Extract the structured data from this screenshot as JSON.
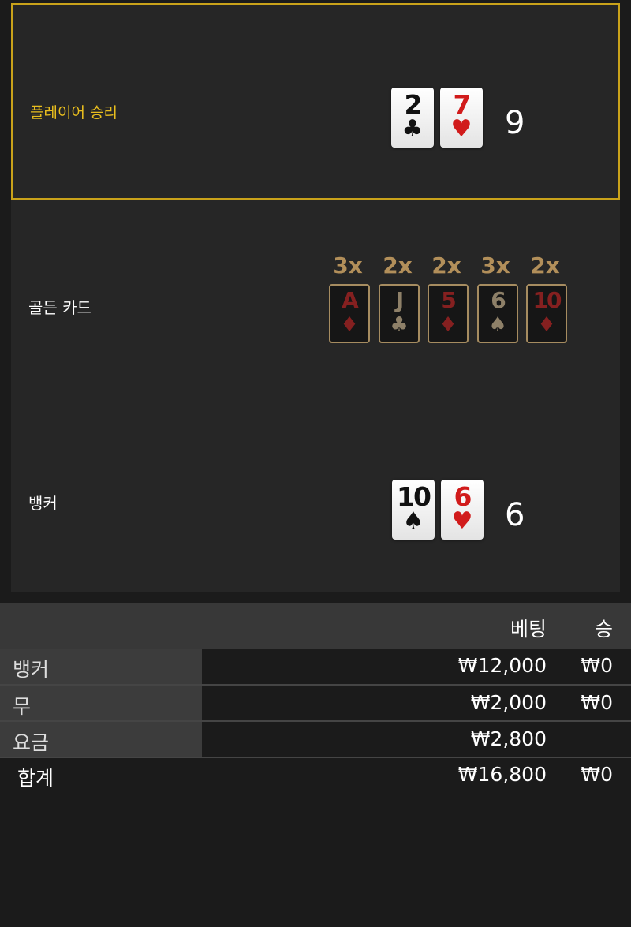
{
  "player": {
    "label": "플레이어 승리",
    "cards": [
      {
        "rank": "2",
        "suit": "♣",
        "color": "black"
      },
      {
        "rank": "7",
        "suit": "♥",
        "color": "red"
      }
    ],
    "score": "9"
  },
  "golden": {
    "label": "골든 카드",
    "cards": [
      {
        "multiplier": "3x",
        "rank": "A",
        "suit": "♦",
        "color": "red"
      },
      {
        "multiplier": "2x",
        "rank": "J",
        "suit": "♣",
        "color": "black"
      },
      {
        "multiplier": "2x",
        "rank": "5",
        "suit": "♦",
        "color": "red"
      },
      {
        "multiplier": "3x",
        "rank": "6",
        "suit": "♠",
        "color": "black"
      },
      {
        "multiplier": "2x",
        "rank": "10",
        "suit": "♦",
        "color": "red"
      }
    ]
  },
  "banker": {
    "label": "뱅커",
    "cards": [
      {
        "rank": "10",
        "suit": "♠",
        "color": "black"
      },
      {
        "rank": "6",
        "suit": "♥",
        "color": "red"
      }
    ],
    "score": "6"
  },
  "table": {
    "headers": {
      "bet": "베팅",
      "win": "승"
    },
    "rows": [
      {
        "name": "뱅커",
        "bet": "₩12,000",
        "win": "₩0"
      },
      {
        "name": "무",
        "bet": "₩2,000",
        "win": "₩0"
      },
      {
        "name": "요금",
        "bet": "₩2,800",
        "win": ""
      }
    ],
    "total": {
      "name": "합계",
      "bet": "₩16,800",
      "win": "₩0"
    }
  },
  "colors": {
    "winner_highlight": "#c9a21a",
    "red_suit": "#d11b1b",
    "golden_frame": "#a68c60"
  }
}
